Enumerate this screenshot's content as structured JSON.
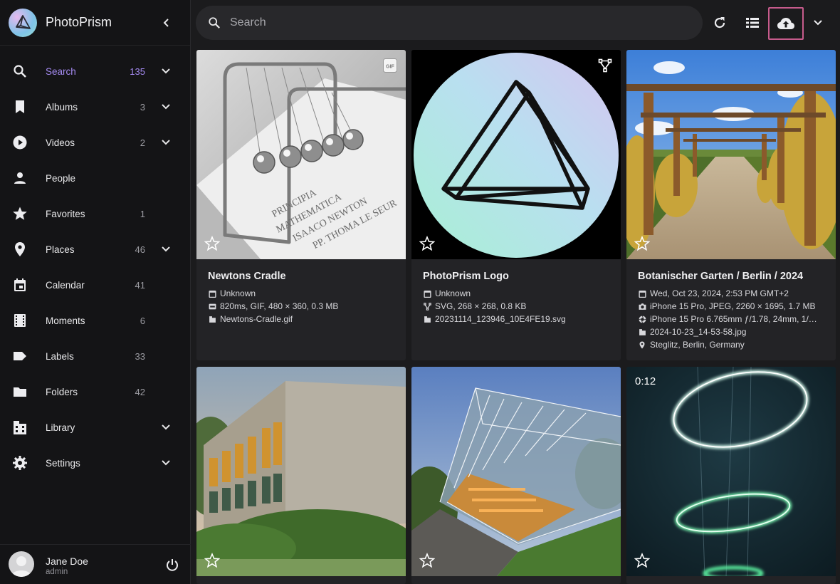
{
  "app": {
    "title": "PhotoPrism"
  },
  "sidebar": {
    "items": [
      {
        "label": "Search",
        "count": "135",
        "icon": "search-icon",
        "expandable": true,
        "active": true
      },
      {
        "label": "Albums",
        "count": "3",
        "icon": "bookmark-icon",
        "expandable": true
      },
      {
        "label": "Videos",
        "count": "2",
        "icon": "play-circle-icon",
        "expandable": true
      },
      {
        "label": "People",
        "count": "",
        "icon": "person-icon",
        "expandable": false
      },
      {
        "label": "Favorites",
        "count": "1",
        "icon": "star-icon",
        "expandable": false
      },
      {
        "label": "Places",
        "count": "46",
        "icon": "map-pin-icon",
        "expandable": true
      },
      {
        "label": "Calendar",
        "count": "41",
        "icon": "calendar-icon",
        "expandable": false
      },
      {
        "label": "Moments",
        "count": "6",
        "icon": "film-icon",
        "expandable": false
      },
      {
        "label": "Labels",
        "count": "33",
        "icon": "label-tag-icon",
        "expandable": false
      },
      {
        "label": "Folders",
        "count": "42",
        "icon": "folder-icon",
        "expandable": false
      },
      {
        "label": "Library",
        "count": "",
        "icon": "library-icon",
        "expandable": true
      },
      {
        "label": "Settings",
        "count": "",
        "icon": "gear-icon",
        "expandable": true
      }
    ]
  },
  "user": {
    "name": "Jane Doe",
    "role": "admin"
  },
  "toolbar": {
    "search_placeholder": "Search"
  },
  "colors": {
    "accent": "#a58bf2",
    "upload_highlight": "#c75b8c",
    "card_bg": "#232326",
    "sidebar_bg": "#141416"
  },
  "cards": [
    {
      "title": "Newtons Cradle",
      "badge": "GIF",
      "meta": [
        {
          "icon": "calendar-icon",
          "text": "Unknown"
        },
        {
          "icon": "gif-icon",
          "text": "820ms, GIF, 480 × 360, 0.3 MB"
        },
        {
          "icon": "file-icon",
          "text": "Newtons-Cradle.gif"
        }
      ]
    },
    {
      "title": "PhotoPrism Logo",
      "badge": "vector",
      "meta": [
        {
          "icon": "calendar-icon",
          "text": "Unknown"
        },
        {
          "icon": "vector-icon",
          "text": "SVG, 268 × 268, 0.8 KB"
        },
        {
          "icon": "file-icon",
          "text": "20231114_123946_10E4FE19.svg"
        }
      ]
    },
    {
      "title": "Botanischer Garten / Berlin / 2024",
      "badge": "",
      "meta": [
        {
          "icon": "calendar-icon",
          "text": "Wed, Oct 23, 2024, 2:53 PM GMT+2"
        },
        {
          "icon": "camera-icon",
          "text": "iPhone 15 Pro, JPEG, 2260 × 1695, 1.7 MB"
        },
        {
          "icon": "aperture-icon",
          "text": "iPhone 15 Pro 6.765mm ƒ/1.78, 24mm, 1/…"
        },
        {
          "icon": "file-icon",
          "text": "2024-10-23_14-53-58.jpg"
        },
        {
          "icon": "map-pin-icon",
          "text": "Steglitz, Berlin, Germany"
        }
      ]
    },
    {
      "title": "",
      "badge": "",
      "meta": []
    },
    {
      "title": "",
      "badge": "",
      "meta": []
    },
    {
      "title": "",
      "badge": "",
      "duration": "0:12",
      "meta": []
    }
  ]
}
